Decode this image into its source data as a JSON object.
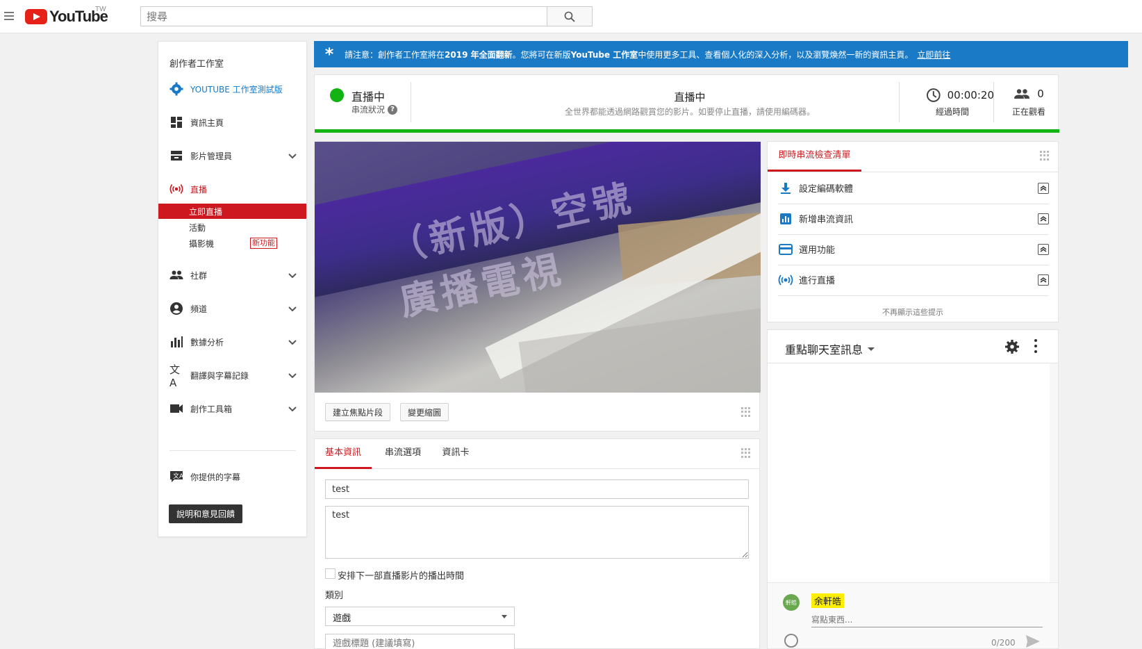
{
  "masthead": {
    "logo_text": "YouTube",
    "region": "TW",
    "search_placeholder": "搜尋"
  },
  "sidebar": {
    "title": "創作者工作室",
    "studio_beta": "YOUTUBE 工作室測試版",
    "items": [
      {
        "label": "資訊主頁",
        "icon": "dashboard-icon"
      },
      {
        "label": "影片管理員",
        "icon": "video-manager-icon"
      },
      {
        "label": "直播",
        "icon": "live-icon"
      },
      {
        "label": "社群",
        "icon": "community-icon"
      },
      {
        "label": "頻道",
        "icon": "channel-icon"
      },
      {
        "label": "數據分析",
        "icon": "analytics-icon"
      },
      {
        "label": "翻譯與字幕記錄",
        "icon": "translate-icon"
      },
      {
        "label": "創作工具箱",
        "icon": "create-icon"
      }
    ],
    "live_sub": [
      "立即直播",
      "活動",
      "攝影機"
    ],
    "new_badge": "新功能",
    "contributions": "你提供的字幕",
    "help_button": "說明和意見回饋"
  },
  "notice": {
    "prefix": "請注意：創作者工作室將在 ",
    "year": "2019 年全面翻新",
    "middle": "。您將可在新版 ",
    "product": "YouTube 工作室",
    "suffix": "中使用更多工具、查看個人化的深入分析，以及瀏覽煥然一新的資訊主頁。",
    "link": "立即前往"
  },
  "status": {
    "state": "直播中",
    "state_label": "串流狀況",
    "center_title": "直播中",
    "center_sub": "全世界都能透過網路觀賞您的影片。如要停止直播，請使用編碼器。",
    "elapsed": "00:00:20",
    "elapsed_label": "經過時間",
    "viewers": "0",
    "viewers_label": "正在觀看"
  },
  "preview": {
    "book_text": "（新版）空號廣播電視",
    "create_clip": "建立焦點片段",
    "change_thumbnail": "變更縮圖"
  },
  "info": {
    "tabs": [
      "基本資訊",
      "串流選項",
      "資訊卡"
    ],
    "title_value": "test",
    "description_value": "test",
    "schedule_label": "安排下一部直播影片的播出時間",
    "category_label": "類別",
    "category_value": "遊戲",
    "game_placeholder": "遊戲標題 (建議填寫)"
  },
  "checklist": {
    "tab": "即時串流檢查清單",
    "rows": [
      {
        "label": "設定編碼軟體",
        "icon": "download-icon"
      },
      {
        "label": "新增串流資訊",
        "icon": "bar-chart-icon"
      },
      {
        "label": "選用功能",
        "icon": "card-icon"
      },
      {
        "label": "進行直播",
        "icon": "live-broadcast-icon"
      }
    ],
    "footer": "不再顯示這些提示"
  },
  "chat": {
    "title": "重點聊天室訊息",
    "avatar_text": "軒皓",
    "username": "余軒皓",
    "input_placeholder": "寫點東西...",
    "counter": "0/200"
  },
  "colors": {
    "accent_red": "#cc181e",
    "notice_blue": "#1b7ac6",
    "live_green": "#12b312",
    "studio_blue": "#167ac6"
  }
}
